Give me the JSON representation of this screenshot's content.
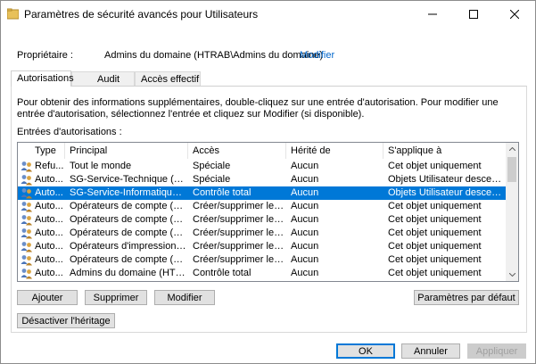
{
  "window": {
    "title": "Paramètres de sécurité avancés pour Utilisateurs",
    "icons": {
      "app": "folder-shield-icon",
      "minimize": "minimize-icon",
      "maximize": "maximize-icon",
      "close": "close-icon"
    }
  },
  "owner": {
    "label": "Propriétaire :",
    "value": "Admins du domaine (HTRAB\\Admins du domaine)",
    "change_link": "Modifier"
  },
  "tabs": [
    {
      "label": "Autorisations",
      "active": true
    },
    {
      "label": "Audit",
      "active": false
    },
    {
      "label": "Accès effectif",
      "active": false
    }
  ],
  "info_text": "Pour obtenir des informations supplémentaires, double-cliquez sur une entrée d'autorisation. Pour modifier une entrée d'autorisation, sélectionnez l'entrée et cliquez sur Modifier (si disponible).",
  "entries_label": "Entrées d'autorisations :",
  "table": {
    "columns": [
      "Type",
      "Principal",
      "Accès",
      "Hérité de",
      "S'applique à"
    ],
    "row_icon": "users-group-icon",
    "selected_color": "#0078d7",
    "rows": [
      {
        "type": "Refu...",
        "principal": "Tout le monde",
        "access": "Spéciale",
        "inherited": "Aucun",
        "applies": "Cet objet uniquement",
        "selected": false
      },
      {
        "type": "Auto...",
        "principal": "SG-Service-Technique (HTRA...",
        "access": "Spéciale",
        "inherited": "Aucun",
        "applies": "Objets Utilisateur descendants",
        "selected": false
      },
      {
        "type": "Auto...",
        "principal": "SG-Service-Informatique (HT...",
        "access": "Contrôle total",
        "inherited": "Aucun",
        "applies": "Objets Utilisateur descendants",
        "selected": true
      },
      {
        "type": "Auto...",
        "principal": "Opérateurs de compte (HTR...",
        "access": "Créer/supprimer les o...",
        "inherited": "Aucun",
        "applies": "Cet objet uniquement",
        "selected": false
      },
      {
        "type": "Auto...",
        "principal": "Opérateurs de compte (HTR...",
        "access": "Créer/supprimer les o...",
        "inherited": "Aucun",
        "applies": "Cet objet uniquement",
        "selected": false
      },
      {
        "type": "Auto...",
        "principal": "Opérateurs de compte (HTR...",
        "access": "Créer/supprimer les o...",
        "inherited": "Aucun",
        "applies": "Cet objet uniquement",
        "selected": false
      },
      {
        "type": "Auto...",
        "principal": "Opérateurs d'impression (HT...",
        "access": "Créer/supprimer les o...",
        "inherited": "Aucun",
        "applies": "Cet objet uniquement",
        "selected": false
      },
      {
        "type": "Auto...",
        "principal": "Opérateurs de compte (HTR...",
        "access": "Créer/supprimer les o...",
        "inherited": "Aucun",
        "applies": "Cet objet uniquement",
        "selected": false
      },
      {
        "type": "Auto...",
        "principal": "Admins du domaine (HTRAB...",
        "access": "Contrôle total",
        "inherited": "Aucun",
        "applies": "Cet objet uniquement",
        "selected": false
      }
    ]
  },
  "buttons": {
    "add": "Ajouter",
    "remove": "Supprimer",
    "edit": "Modifier",
    "defaults": "Paramètres par défaut",
    "disable_inheritance": "Désactiver l'héritage",
    "ok": "OK",
    "cancel": "Annuler",
    "apply": "Appliquer"
  }
}
